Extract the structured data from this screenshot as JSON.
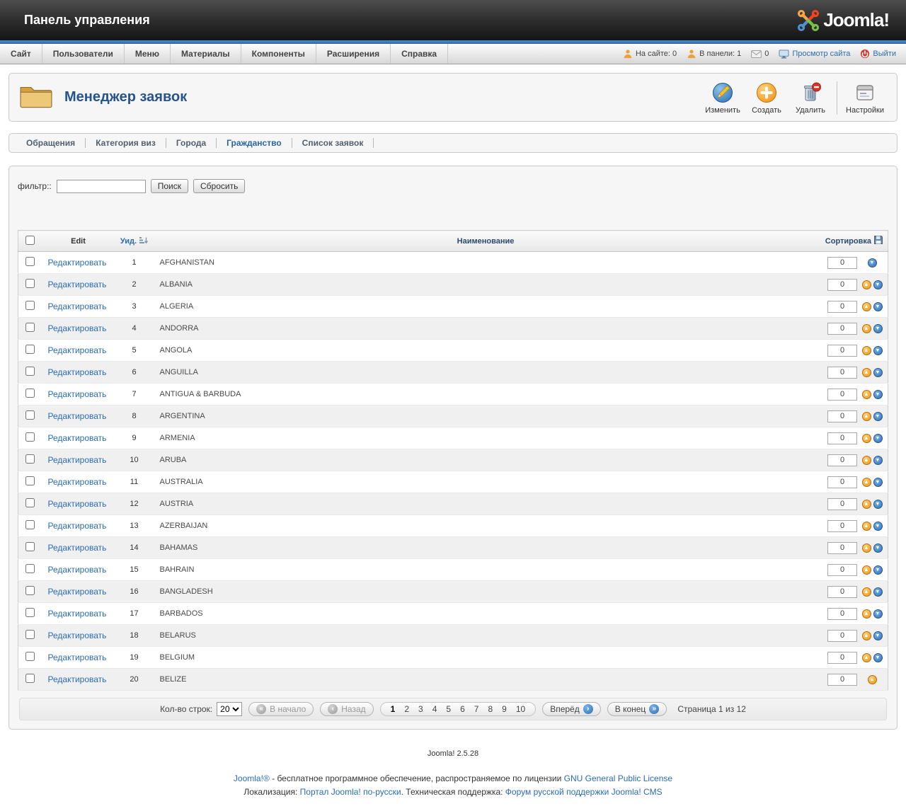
{
  "header": {
    "title": "Панель управления",
    "logo_text": "Joomla!"
  },
  "menubar": {
    "items": [
      "Сайт",
      "Пользователи",
      "Меню",
      "Материалы",
      "Компоненты",
      "Расширения",
      "Справка"
    ],
    "status": {
      "on_site": "На сайте: 0",
      "in_panel": "В панели: 1",
      "messages": "0",
      "view_site": "Просмотр сайта",
      "logout": "Выйти"
    }
  },
  "toolbar": {
    "page_title": "Менеджер заявок",
    "buttons": [
      "Изменить",
      "Создать",
      "Удалить",
      "Настройки"
    ]
  },
  "subnav": {
    "items": [
      "Обращения",
      "Категория виз",
      "Города",
      "Гражданство",
      "Список заявок"
    ],
    "active": "Гражданство"
  },
  "filter": {
    "label": "фильтр::",
    "value": "",
    "search": "Поиск",
    "reset": "Сбросить"
  },
  "table": {
    "headers": {
      "edit": "Edit",
      "uid": "Уид.",
      "name": "Наименование",
      "order": "Сортировка"
    },
    "edit_label": "Редактировать",
    "rows": [
      {
        "uid": "1",
        "name": "AFGHANISTAN",
        "order": "0"
      },
      {
        "uid": "2",
        "name": "ALBANIA",
        "order": "0"
      },
      {
        "uid": "3",
        "name": "ALGERIA",
        "order": "0"
      },
      {
        "uid": "4",
        "name": "ANDORRA",
        "order": "0"
      },
      {
        "uid": "5",
        "name": "ANGOLA",
        "order": "0"
      },
      {
        "uid": "6",
        "name": "ANGUILLA",
        "order": "0"
      },
      {
        "uid": "7",
        "name": "ANTIGUA & BARBUDA",
        "order": "0"
      },
      {
        "uid": "8",
        "name": "ARGENTINA",
        "order": "0"
      },
      {
        "uid": "9",
        "name": "ARMENIA",
        "order": "0"
      },
      {
        "uid": "10",
        "name": "ARUBA",
        "order": "0"
      },
      {
        "uid": "11",
        "name": "AUSTRALIA",
        "order": "0"
      },
      {
        "uid": "12",
        "name": "AUSTRIA",
        "order": "0"
      },
      {
        "uid": "13",
        "name": "AZERBAIJAN",
        "order": "0"
      },
      {
        "uid": "14",
        "name": "BAHAMAS",
        "order": "0"
      },
      {
        "uid": "15",
        "name": "BAHRAIN",
        "order": "0"
      },
      {
        "uid": "16",
        "name": "BANGLADESH",
        "order": "0"
      },
      {
        "uid": "17",
        "name": "BARBADOS",
        "order": "0"
      },
      {
        "uid": "18",
        "name": "BELARUS",
        "order": "0"
      },
      {
        "uid": "19",
        "name": "BELGIUM",
        "order": "0"
      },
      {
        "uid": "20",
        "name": "BELIZE",
        "order": "0"
      }
    ]
  },
  "pagination": {
    "limit_label": "Кол-во строк:",
    "limit_value": "20",
    "first": "В начало",
    "prev": "Назад",
    "pages": [
      "1",
      "2",
      "3",
      "4",
      "5",
      "6",
      "7",
      "8",
      "9",
      "10"
    ],
    "active_page": "1",
    "next": "Вперёд",
    "last": "В конец",
    "info": "Страница 1 из 12"
  },
  "footer": {
    "version": "Joomla! 2.5.28",
    "license": {
      "link_joomla": "Joomla!®",
      "text_mid": " - бесплатное программное обеспечение, распространяемое по лицензии ",
      "link_gnu": "GNU General Public License"
    },
    "support": {
      "text_localization": "Локализация: ",
      "link_portal": "Портал Joomla! по-русски",
      "text_support": ". Техническая поддержка: ",
      "link_forum": "Форум русской поддержки Joomla! CMS"
    }
  }
}
